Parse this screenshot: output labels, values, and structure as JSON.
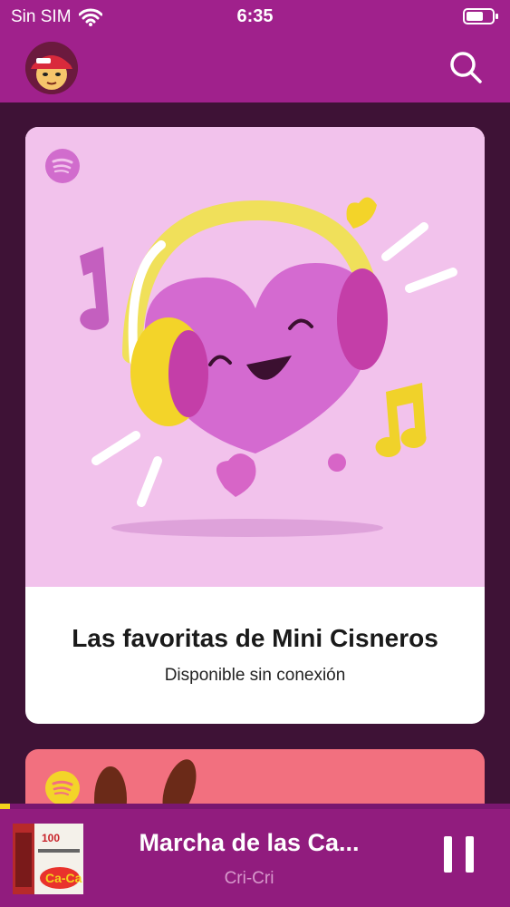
{
  "status_bar": {
    "carrier": "Sin SIM",
    "time": "6:35"
  },
  "header": {
    "profile_icon": "avatar",
    "search_icon": "search-icon"
  },
  "playlist_card": {
    "title": "Las favoritas de Mini Cisneros",
    "subtitle": "Disponible sin conexión",
    "art_icon": "heart-with-headphones",
    "badge_icon": "spotify-icon"
  },
  "next_card": {
    "badge_icon": "spotify-icon"
  },
  "now_playing": {
    "title": "Marcha de las Ca...",
    "artist": "Cri-Cri",
    "progress": 0.02,
    "control_icon": "pause-icon"
  },
  "colors": {
    "header": "#a0218c",
    "background": "#3e1236",
    "card_art": "#f2c2ec",
    "player": "#911c7e",
    "progress": "#f3d21c",
    "artist_text": "#d89acd"
  }
}
